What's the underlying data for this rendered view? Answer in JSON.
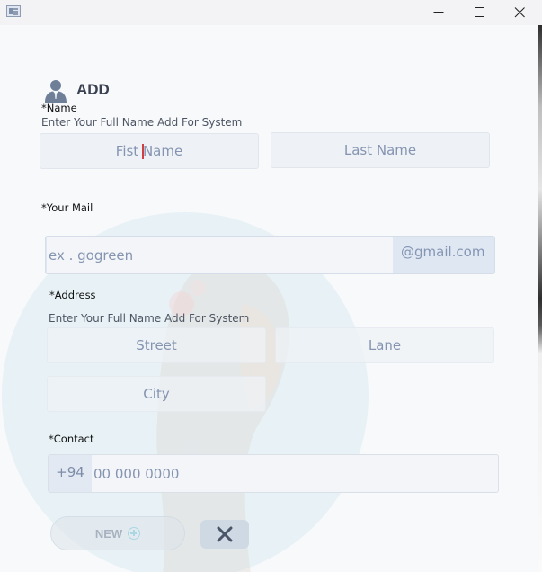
{
  "window": {
    "controls": [
      "minimize-icon",
      "maximize-icon",
      "close-icon"
    ]
  },
  "header": {
    "icon": "user-icon",
    "title": "ADD"
  },
  "name_section": {
    "label": "*Name",
    "hint": "Enter Your Full Name Add For System",
    "first_name_before_caret": "Fist ",
    "first_name_after_caret": "Name",
    "last_name_placeholder": "Last Name"
  },
  "mail_section": {
    "label": "*Your Mail",
    "placeholder": "ex . gogreen",
    "suffix": "@gmail.com"
  },
  "address_section": {
    "label": "*Address",
    "hint": "Enter Your Full Name Add For System",
    "street_placeholder": "Street",
    "lane_placeholder": "Lane",
    "city_placeholder": "City"
  },
  "contact_section": {
    "label": "*Contact",
    "country_code": "+94",
    "placeholder": "00 000 0000"
  },
  "actions": {
    "new_label": "NEW",
    "new_icon": "plus-circle-icon",
    "cancel_icon": "close-icon"
  },
  "colors": {
    "placeholder_text": "#8595b1",
    "field_bg": "#eef1f5",
    "mail_suffix_bg": "#dfe7f2",
    "background_circle": "#e6f1f5",
    "caret": "#d04040"
  }
}
